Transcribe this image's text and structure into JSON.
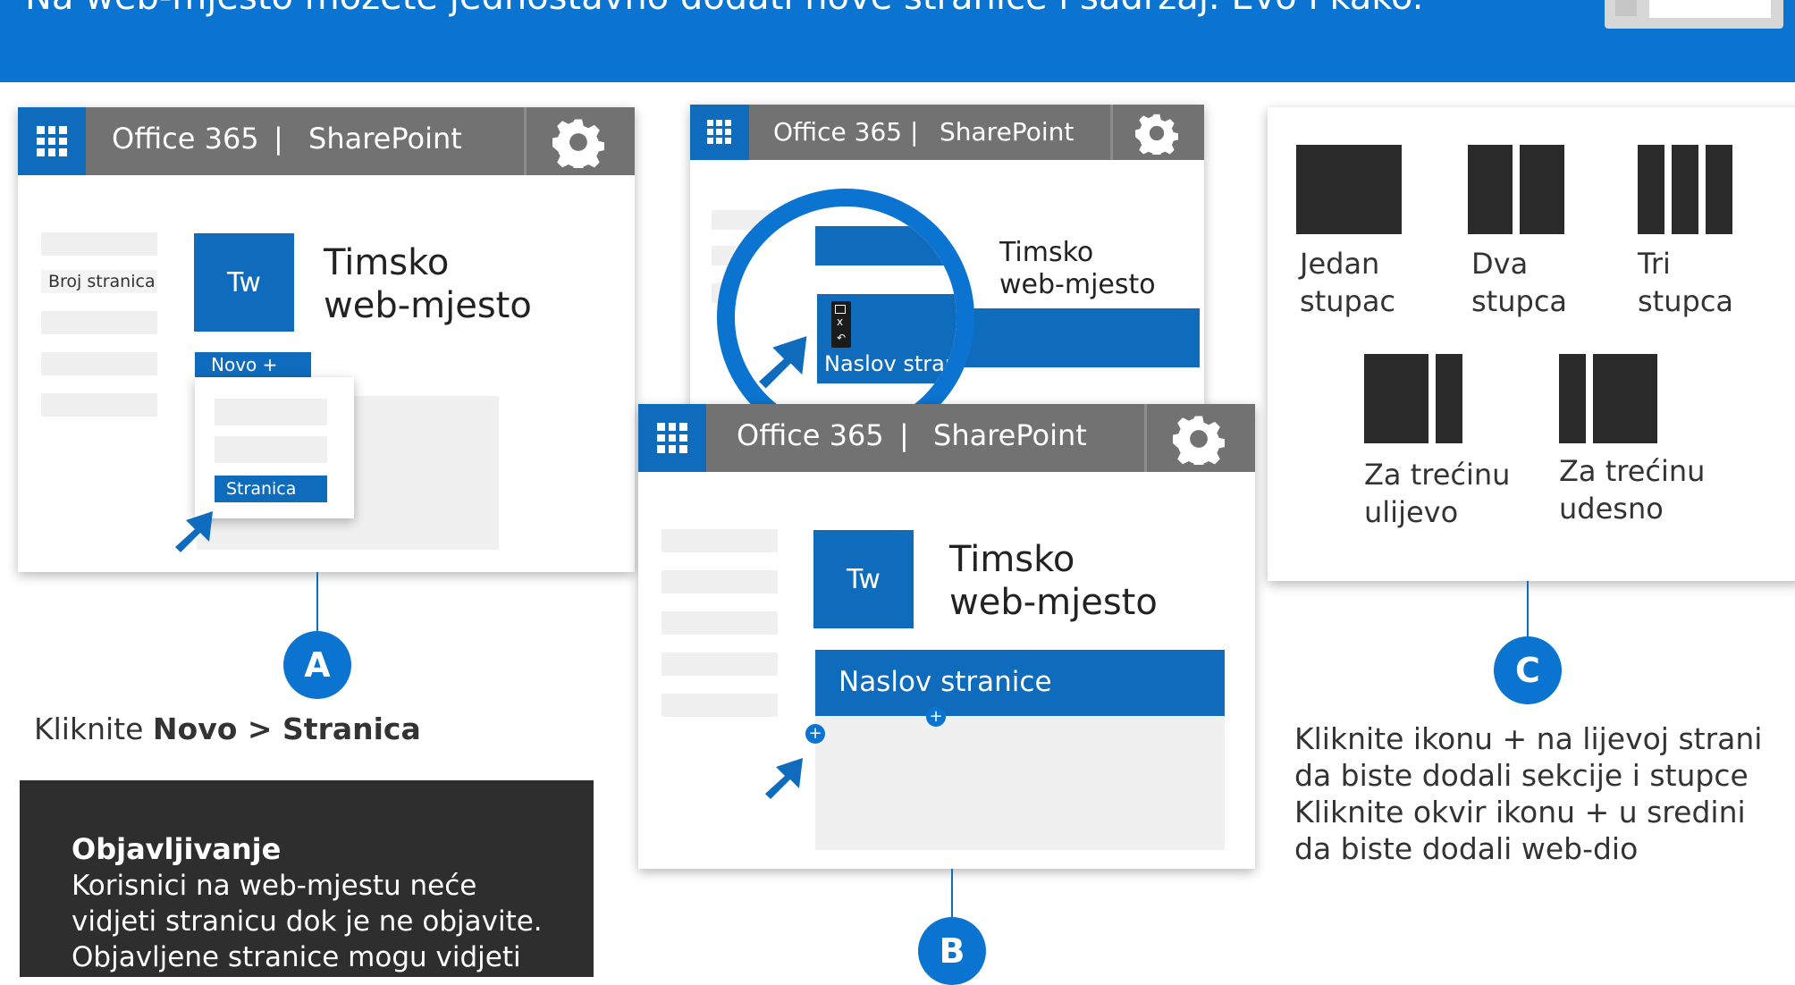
{
  "banner": {
    "text": "Na web-mjesto možete jednostavno dodati nove stranice i sadržaj. Evo i kako."
  },
  "panel_a": {
    "app_title": "Office 365",
    "separator": "|",
    "app_name": "SharePoint",
    "sidebar_item": "Broj stranica",
    "tile_initials": "Tw",
    "site_title_line1": "Timsko",
    "site_title_line2": "web-mjesto",
    "new_button": "Novo +",
    "menu_item": "Stranica"
  },
  "panel_zoom": {
    "app_title": "Office 365",
    "separator": "|",
    "app_name": "SharePoint",
    "site_title_line1": "Timsko",
    "site_title_line2": "web-mjesto",
    "page_title": "Naslov stranice",
    "toolbar_close": "x"
  },
  "panel_b": {
    "app_title": "Office 365",
    "separator": "|",
    "app_name": "SharePoint",
    "tile_initials": "Tw",
    "site_title_line1": "Timsko",
    "site_title_line2": "web-mjesto",
    "page_title": "Naslov stranice",
    "add_left": "+",
    "add_center": "+"
  },
  "layouts": [
    {
      "line1": "Jedan",
      "line2": "stupac"
    },
    {
      "line1": "Dva",
      "line2": "stupca"
    },
    {
      "line1": "Tri",
      "line2": "stupca"
    },
    {
      "line1": "Za trećinu",
      "line2": "ulijevo"
    },
    {
      "line1": "Za trećinu",
      "line2": "udesno"
    }
  ],
  "steps": {
    "a": "A",
    "b": "B",
    "c": "C"
  },
  "step_a_text": {
    "prefix": "Kliknite ",
    "novo": "Novo",
    "arrow": " > ",
    "stranica": "Stranica"
  },
  "step_c_text": {
    "line1": "Kliknite ikonu + na lijevoj strani",
    "line2": "da biste dodali sekcije i stupce",
    "line3": "Kliknite okvir ikonu + u sredini",
    "line4": "da biste dodali web-dio"
  },
  "publish_note": {
    "title": "Objavljivanje",
    "line1": "Korisnici na web-mjestu neće",
    "line2": "vidjeti stranicu dok je ne objavite.",
    "line3": "Objavljene stranice mogu vidjeti"
  },
  "colors": {
    "accent": "#0a74d0",
    "tile_blue": "#0f6cbd",
    "suite_bar": "#727272",
    "note_bg": "#2e2e2e",
    "layout_block": "#2b2b2b"
  },
  "icons": {
    "waffle": "app-launcher-icon",
    "gear": "settings-gear-icon",
    "cursor": "mouse-pointer-icon"
  }
}
